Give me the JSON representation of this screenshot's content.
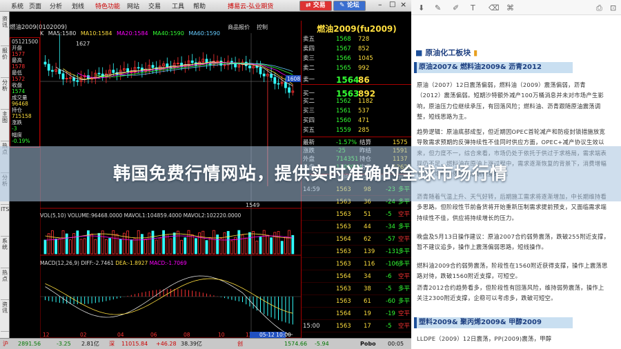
{
  "menu": {
    "items": [
      "系统",
      "页面",
      "分析",
      "划线",
      "特色功能",
      "网站",
      "交易",
      "工具",
      "帮助"
    ],
    "title": "搏易云-弘业期货",
    "trade_btn": "交易",
    "forum_btn": "论坛"
  },
  "symbol": {
    "header": "燃油2009(0102009)",
    "price_title": "商品报价",
    "ctl": "控制"
  },
  "vtabs": [
    "资讯",
    "报价",
    "分析",
    "主图",
    "热点",
    "分析",
    "ITS",
    "系统",
    "热点",
    "资讯"
  ],
  "legend": {
    "k": "K",
    "ma5": "MA5:1580",
    "ma10": "MA10:1584",
    "ma20": "MA20:1584",
    "ma40": "MA40:1590",
    "ma60": "MA60:1590"
  },
  "marks": {
    "high": "1627",
    "low": "1549",
    "cur": "1608"
  },
  "info": [
    {
      "l": "05121500",
      "c": "#ddd"
    },
    {
      "l": "开盘",
      "c": "#ddd"
    },
    {
      "l": "1577",
      "c": "#f33"
    },
    {
      "l": "最高",
      "c": "#ddd"
    },
    {
      "l": "1578",
      "c": "#f33"
    },
    {
      "l": "最低",
      "c": "#ddd"
    },
    {
      "l": "1572",
      "c": "#f33"
    },
    {
      "l": "收盘",
      "c": "#ddd"
    },
    {
      "l": "1574",
      "c": "#3f3"
    },
    {
      "l": "成交量",
      "c": "#ddd"
    },
    {
      "l": "96468",
      "c": "#ffdf3f"
    },
    {
      "l": "持仓",
      "c": "#ddd"
    },
    {
      "l": "715158",
      "c": "#ffdf3f"
    },
    {
      "l": "涨跌",
      "c": "#ddd"
    },
    {
      "l": "-3",
      "c": "#3f3"
    },
    {
      "l": "幅度",
      "c": "#ddd"
    },
    {
      "l": "-0.19%",
      "c": "#3f3"
    }
  ],
  "yaxis": [
    "1600",
    "1580",
    "1560",
    "1540",
    "1520",
    "15万",
    "10",
    "5"
  ],
  "volleg": "VOL(5,10) VOLUME:96468.0000 MAVOL1:104859.4000 MAVOL2:102220.0000",
  "macdleg": {
    "a": "MACD(12,26,9)",
    "b": "DIFF:-2.7461",
    "c": "DEA:-1.8927",
    "d": "MACD:-1.7069"
  },
  "xaxis": [
    "12",
    "02",
    "04",
    "06",
    "08",
    "10",
    "12",
    "05-12 10:00"
  ],
  "book": {
    "title": "燃油2009(fu2009)",
    "sells": [
      {
        "l": "卖五",
        "p": "1568",
        "v": "728"
      },
      {
        "l": "卖四",
        "p": "1567",
        "v": "852"
      },
      {
        "l": "卖三",
        "p": "1566",
        "v": "1045"
      },
      {
        "l": "卖二",
        "p": "1565",
        "v": "992"
      },
      {
        "l": "卖一",
        "p": "1564",
        "v": "86"
      }
    ],
    "buys": [
      {
        "l": "买一",
        "p": "1563",
        "v": "892"
      },
      {
        "l": "买二",
        "p": "1562",
        "v": "1182"
      },
      {
        "l": "买三",
        "p": "1561",
        "v": "537"
      },
      {
        "l": "买四",
        "p": "1560",
        "v": "471"
      },
      {
        "l": "买五",
        "p": "1559",
        "v": "285"
      }
    ],
    "stats": [
      {
        "l": "最新",
        "p": "-1.57%",
        "l2": "结算",
        "v2": "1575"
      },
      {
        "l": "涨跌",
        "p": "-25",
        "l2": "昨结",
        "v2": "1591"
      },
      {
        "l": "外盘",
        "p": "714351",
        "l2": "持仓",
        "v2": "1137"
      },
      {
        "l": "外盘",
        "p": "1208064",
        "l2": "内盘",
        "v2": "1262556"
      }
    ],
    "tick_header": [
      "北京",
      "价格",
      "现手",
      "增仓",
      "开平"
    ],
    "ticks": [
      {
        "t": "14:59",
        "p": "1563",
        "v": "98",
        "c": "-23",
        "s": "多平"
      },
      {
        "t": "",
        "p": "1563",
        "v": "36",
        "c": "-24",
        "s": "多平"
      },
      {
        "t": "",
        "p": "1563",
        "v": "51",
        "c": "-5",
        "s": "空平"
      },
      {
        "t": "",
        "p": "1563",
        "v": "44",
        "c": "-34",
        "s": "多平"
      },
      {
        "t": "",
        "p": "1564",
        "v": "62",
        "c": "-57",
        "s": "空平"
      },
      {
        "t": "",
        "p": "1563",
        "v": "139",
        "c": "-131",
        "s": "多平"
      },
      {
        "t": "",
        "p": "1563",
        "v": "116",
        "c": "-106",
        "s": "多平"
      },
      {
        "t": "",
        "p": "1564",
        "v": "34",
        "c": "-6",
        "s": "空平"
      },
      {
        "t": "",
        "p": "1563",
        "v": "38",
        "c": "-5",
        "s": "多平"
      },
      {
        "t": "",
        "p": "1563",
        "v": "61",
        "c": "-60",
        "s": "多平"
      },
      {
        "t": "",
        "p": "1564",
        "v": "19",
        "c": "-19",
        "s": "空平"
      },
      {
        "t": "15:00",
        "p": "1563",
        "v": "17",
        "c": "-5",
        "s": "空平"
      }
    ]
  },
  "status": {
    "a": "沪",
    "b": "2891.56",
    "c": "-3.25",
    "d": "2.81亿",
    "e": "深",
    "f": "11015.84",
    "g": "+46.28",
    "h": "38.39亿",
    "i": "创",
    "j": "1574.66",
    "k": "-5.94",
    "l": "Pobo",
    "m": "00:05"
  },
  "reader": {
    "title": "原油化工板块",
    "h1": "原油2007& 燃料油2009& 沥青2012",
    "p1": "原油（2007）12日震荡偏弱，燃料油（2009）震荡偏弱，沥青（2012）震荡偏弱。短期沙特额外减产100万桶消息并未对市场产生影响，原油压力位继续承压，有回落风险；燃料油、沥青跟随原油震荡调整，短线思路为主。",
    "p2": "趋势逻辑：原油底部成型，但近期因OPEC首轮减产和防疫封锁措施放宽导致需求预期的反弹持续性不佳同时供应方面，OPEC+减产协议生效以来，但力度不一，综合来看，市场仍处于依托于供过于求格局，需求端表现仍不足，燃料油在原油上涨过程中，需求逐渐恢复的背景下，消费增幅有限，燃料油依赖需求端恢复逐渐。",
    "p3": "沥青随着气温上升、天气好转，后期施工需求将逐渐增加，中长期维持看多思路。但阶段性节前备货将开始重新压制需求提前预支，又面临需求端持续性不佳，供应将持续增长的压力。",
    "p4": "晚盘及5月13日操作建议：原油2007合约弱势震荡，跌破255附近支撑，暂不建议追多，操作上震荡偏弱思路，短线操作。",
    "p5": "燃料油2009合约弱势震荡，阶段性在1560附近获得支撑，操作上震荡思路对待，跌破1560附近支撑，可短空。",
    "p6": "沥青2012合约趋势看多，但阶段性有回落风险，维持弱势震荡，操作上关注2300附近支撑，企稳可以考虑多，跌破可短空。",
    "h2": "塑料2009& 聚丙烯2009& 甲醇2009",
    "p7": "LLDPE（2009）12日震荡，PP(2009)震荡，甲醇"
  },
  "banner": "韩国免费行情网站，提供实时准确的全球市场行情"
}
